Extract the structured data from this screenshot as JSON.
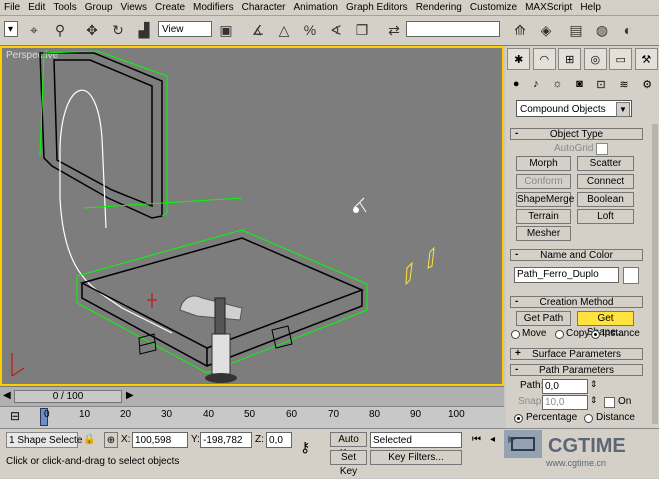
{
  "menu": [
    "File",
    "Edit",
    "Tools",
    "Group",
    "Views",
    "Create",
    "Modifiers",
    "Character",
    "Animation",
    "Graph Editors",
    "Rendering",
    "Customize",
    "MAXScript",
    "Help"
  ],
  "toolbar": {
    "view_select": "View"
  },
  "viewport": {
    "label": "Perspective"
  },
  "command_panel": {
    "category": "Compound Objects",
    "object_type": {
      "title": "Object Type",
      "autogrid": "AutoGrid",
      "buttons": [
        {
          "label": "Morph",
          "enabled": true
        },
        {
          "label": "Scatter",
          "enabled": true
        },
        {
          "label": "Conform",
          "enabled": false
        },
        {
          "label": "Connect",
          "enabled": true
        },
        {
          "label": "ShapeMerge",
          "enabled": true
        },
        {
          "label": "Boolean",
          "enabled": true
        },
        {
          "label": "Terrain",
          "enabled": true
        },
        {
          "label": "Loft",
          "enabled": true
        },
        {
          "label": "Mesher",
          "enabled": true
        }
      ]
    },
    "name_color": {
      "title": "Name and Color",
      "name": "Path_Ferro_Duplo"
    },
    "creation_method": {
      "title": "Creation Method",
      "get_path": "Get Path",
      "get_shape": "Get Shape...",
      "move": "Move",
      "copy": "Copy",
      "instance": "Instance"
    },
    "surface_params": "Surface Parameters",
    "path_params": {
      "title": "Path Parameters",
      "path_label": "Path:",
      "path_value": "0,0",
      "snap_label": "Snap:",
      "snap_value": "10,0",
      "on_label": "On",
      "percentage": "Percentage",
      "distance": "Distance"
    }
  },
  "timeline": {
    "slider": "0 / 100",
    "ticks": [
      "0",
      "10",
      "20",
      "30",
      "40",
      "50",
      "60",
      "70",
      "80",
      "90",
      "100"
    ]
  },
  "status": {
    "selection": "1 Shape Selecte",
    "x_label": "X:",
    "x_value": "100,598",
    "y_label": "Y:",
    "y_value": "-198,782",
    "z_label": "Z:",
    "z_value": "0,0",
    "auto_key": "Auto Key",
    "set_key": "Set Key",
    "selected": "Selected",
    "key_filters": "Key Filters...",
    "prompt": "Click or click-and-drag to select objects"
  },
  "watermark": {
    "brand": "CGTIME",
    "url": "www.cgtime.cn"
  },
  "colors": {
    "viewport_bg": "#7d7d7d",
    "active_border": "#ffcc00",
    "get_shape_bg": "#ffe23c",
    "selection": "#00ff00"
  }
}
